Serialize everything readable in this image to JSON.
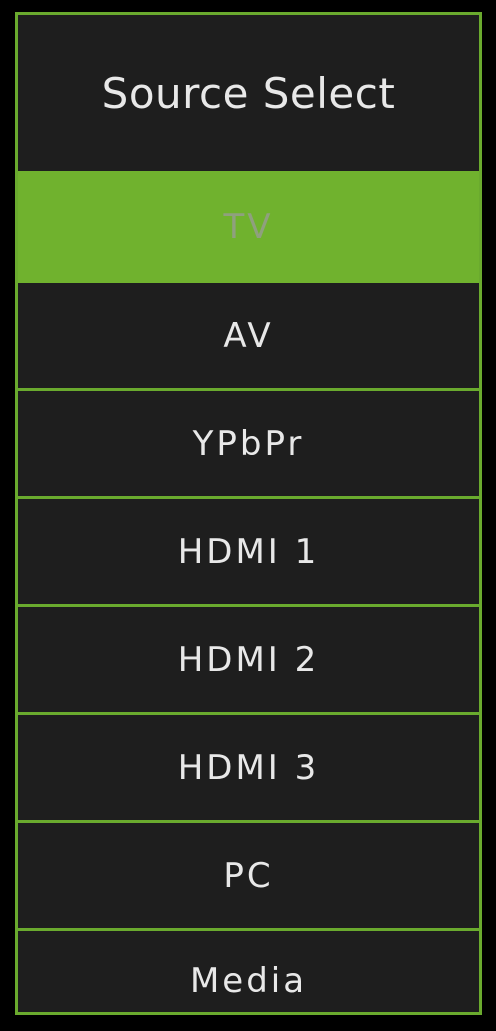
{
  "menu": {
    "title": "Source Select",
    "items": [
      {
        "label": "TV",
        "selected": true
      },
      {
        "label": "AV",
        "selected": false
      },
      {
        "label": "YPbPr",
        "selected": false
      },
      {
        "label": "HDMI 1",
        "selected": false
      },
      {
        "label": "HDMI 2",
        "selected": false
      },
      {
        "label": "HDMI 3",
        "selected": false
      },
      {
        "label": "PC",
        "selected": false
      },
      {
        "label": "Media",
        "selected": false
      }
    ]
  },
  "colors": {
    "accent": "#70b22e",
    "border": "#6aaa2e",
    "background": "#1e1e1e",
    "text": "#e8e8e8",
    "selected_text": "#8fa07e"
  }
}
